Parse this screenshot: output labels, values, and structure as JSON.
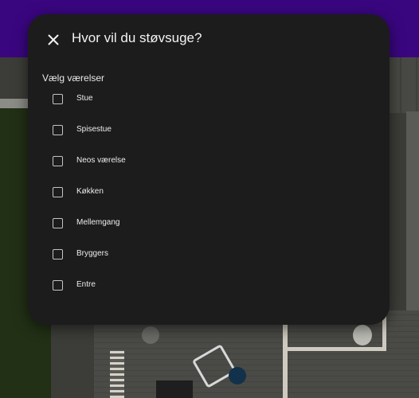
{
  "dialog": {
    "title": "Hvor vil du støvsuge?",
    "section_label": "Vælg værelser",
    "rooms": [
      {
        "label": "Stue",
        "checked": false
      },
      {
        "label": "Spisestue",
        "checked": false
      },
      {
        "label": "Neos værelse",
        "checked": false
      },
      {
        "label": "Køkken",
        "checked": false
      },
      {
        "label": "Mellemgang",
        "checked": false
      },
      {
        "label": "Bryggers",
        "checked": false
      },
      {
        "label": "Entre",
        "checked": false
      }
    ]
  },
  "icons": {
    "close": "close-icon"
  },
  "colors": {
    "dialog_bg": "#1c1c1c",
    "header_bar": "#3a0680"
  }
}
